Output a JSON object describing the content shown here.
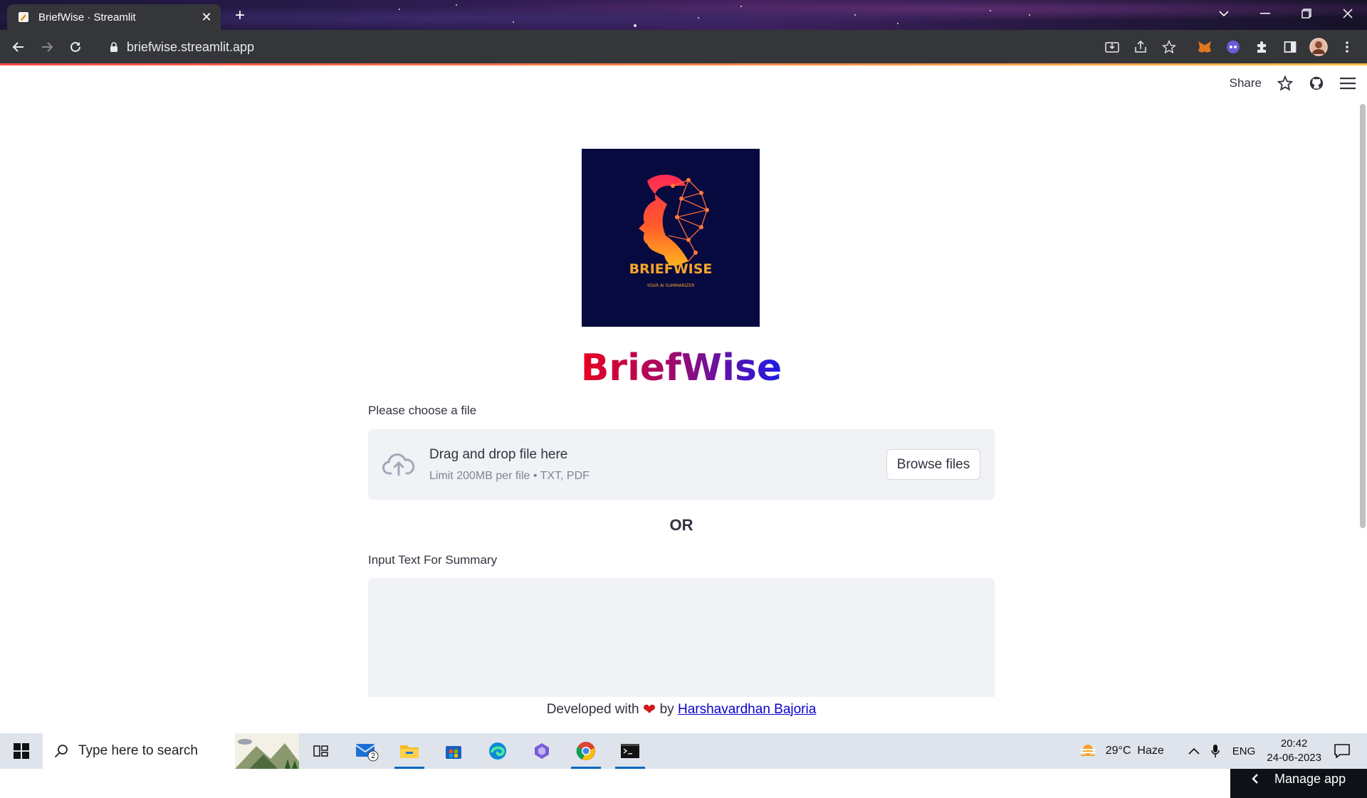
{
  "browser": {
    "tab_title": "BriefWise · Streamlit",
    "url": "briefwise.streamlit.app"
  },
  "header": {
    "share_label": "Share"
  },
  "logo": {
    "brand_text": "BRIEFWISE",
    "tagline": "YOUR AI SUMMARIZER"
  },
  "page": {
    "title": "BriefWise",
    "file_label": "Please choose a file",
    "dropzone_main": "Drag and drop file here",
    "dropzone_sub": "Limit 200MB per file • TXT, PDF",
    "browse_label": "Browse files",
    "or_text": "OR",
    "text_label": "Input Text For Summary",
    "text_value": ""
  },
  "footer": {
    "prefix": "Developed with",
    "by": "by",
    "author": "Harshavardhan Bajoria"
  },
  "manage_app_label": "Manage app",
  "taskbar": {
    "search_placeholder": "Type here to search",
    "mail_badge": "2",
    "weather": "29°C  Haze",
    "language": "ENG",
    "time": "20:42",
    "date": "24-06-2023"
  },
  "colors": {
    "accent": "#ff4b4b",
    "title_gradient": [
      "#e8001f",
      "#a10a6c",
      "#1b1be8"
    ],
    "logo_bg": "#070a3f",
    "link": "#0b00c8"
  }
}
